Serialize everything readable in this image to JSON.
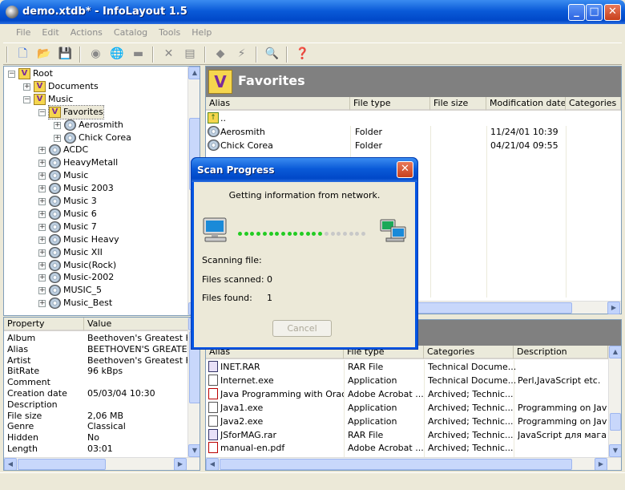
{
  "window": {
    "title": "demo.xtdb* - InfoLayout 1.5",
    "min": "_",
    "max": "□",
    "close": "✕"
  },
  "menu": [
    "File",
    "Edit",
    "Actions",
    "Catalog",
    "Tools",
    "Help"
  ],
  "toolbar_icons": [
    "new-icon",
    "open-icon",
    "save-icon",
    "scan-icon",
    "scan-network-icon",
    "folder-icon",
    "delete-icon",
    "properties-icon",
    "tag-icon",
    "flash-icon",
    "find-icon",
    "help-icon"
  ],
  "tree": {
    "root": "Root",
    "items": [
      {
        "label": "Root",
        "icon": "v"
      },
      {
        "label": "Documents",
        "icon": "v"
      },
      {
        "label": "Music",
        "icon": "v"
      },
      {
        "label": "Favorites",
        "icon": "v"
      },
      {
        "label": "Aerosmith",
        "icon": "cd"
      },
      {
        "label": "Chick Corea",
        "icon": "cd"
      },
      {
        "label": "ACDC",
        "icon": "cd"
      },
      {
        "label": "HeavyMetall",
        "icon": "cd"
      },
      {
        "label": "Music",
        "icon": "cd"
      },
      {
        "label": "Music 2003",
        "icon": "cd"
      },
      {
        "label": "Music 3",
        "icon": "cd"
      },
      {
        "label": "Music 6",
        "icon": "cd"
      },
      {
        "label": "Music 7",
        "icon": "cd"
      },
      {
        "label": "Music Heavy",
        "icon": "cd"
      },
      {
        "label": "Music XII",
        "icon": "cd"
      },
      {
        "label": "Music(Rock)",
        "icon": "cd"
      },
      {
        "label": "Music-2002",
        "icon": "cd"
      },
      {
        "label": "MUSIC_5",
        "icon": "cd"
      },
      {
        "label": "Music_Best",
        "icon": "cd"
      }
    ]
  },
  "properties": {
    "headers": [
      "Property",
      "Value"
    ],
    "rows": [
      [
        "Album",
        "Beethoven's Greatest Hits"
      ],
      [
        "Alias",
        "BEETHOVEN'S GREATEST I"
      ],
      [
        "Artist",
        "Beethoven's Greatest Hits"
      ],
      [
        "BitRate",
        "96 kBps"
      ],
      [
        "Comment",
        ""
      ],
      [
        "Creation date",
        "05/03/04 10:30"
      ],
      [
        "Description",
        ""
      ],
      [
        "File size",
        "2,06 MB"
      ],
      [
        "Genre",
        "Classical"
      ],
      [
        "Hidden",
        "No"
      ],
      [
        "Length",
        "03:01"
      ]
    ]
  },
  "favorites": {
    "title": "Favorites",
    "icon_letter": "V",
    "headers": [
      "Alias",
      "File type",
      "File size",
      "Modification date",
      "Categories"
    ],
    "parent": "..",
    "rows": [
      [
        "Aerosmith",
        "Folder",
        "",
        "11/24/01 10:39",
        ""
      ],
      [
        "Chick Corea",
        "Folder",
        "",
        "04/21/04 09:55",
        ""
      ]
    ]
  },
  "files": {
    "headers": [
      "Alias",
      "File type",
      "Categories",
      "Description"
    ],
    "rows": [
      {
        "cells": [
          "INET.RAR",
          "RAR File",
          "Technical Docume...",
          ""
        ],
        "icon": "rar"
      },
      {
        "cells": [
          "Internet.exe",
          "Application",
          "Technical Docume...",
          "Perl,JavaScript etc."
        ],
        "icon": "exe"
      },
      {
        "cells": [
          "Java Programming with Oracl...",
          "Adobe Acrobat ...",
          "Archived; Technic...",
          ""
        ],
        "icon": "pdf"
      },
      {
        "cells": [
          "Java1.exe",
          "Application",
          "Archived; Technic...",
          "Programming on Java"
        ],
        "icon": "exe"
      },
      {
        "cells": [
          "Java2.exe",
          "Application",
          "Archived; Technic...",
          "Programming on Java"
        ],
        "icon": "exe"
      },
      {
        "cells": [
          "JSforMAG.rar",
          "RAR File",
          "Archived; Technic...",
          "JavaScript для мага"
        ],
        "icon": "rar"
      },
      {
        "cells": [
          "manual-en.pdf",
          "Adobe Acrobat ...",
          "Archived; Technic...",
          ""
        ],
        "icon": "pdf"
      }
    ]
  },
  "dialog": {
    "title": "Scan Progress",
    "message": "Getting information from network.",
    "scanning_label": "Scanning file:",
    "scanned_label": "Files scanned:",
    "scanned_value": "0",
    "found_label": "Files found:",
    "found_value": "1",
    "cancel": "Cancel",
    "progress_active_dots": 14,
    "progress_total_dots": 21,
    "active_color": "#22cc22",
    "inactive_color": "#c8c8c8"
  }
}
